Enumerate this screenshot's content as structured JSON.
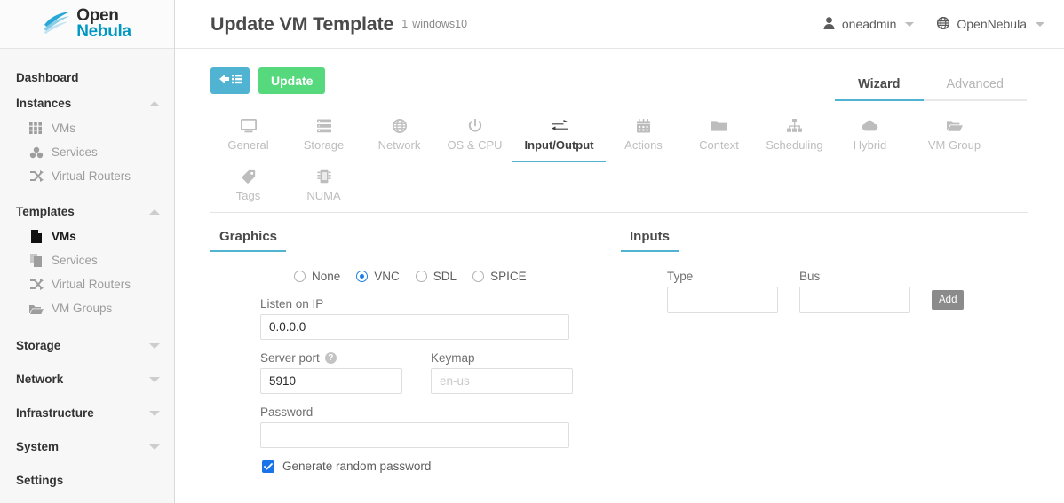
{
  "brand": {
    "logo_line1": "Open",
    "logo_line2": "Nebula",
    "accent": "#0098c3",
    "teal": "#4fb3d1",
    "green": "#56d87d",
    "blue": "#1a73e8"
  },
  "sidebar": {
    "groups": [
      {
        "label": "Dashboard",
        "icon": "",
        "collapsible": false,
        "items": []
      },
      {
        "label": "Instances",
        "caret": "up",
        "collapsible": true,
        "items": [
          {
            "label": "VMs",
            "icon": "grid-icon",
            "active": false
          },
          {
            "label": "Services",
            "icon": "services-icon",
            "active": false
          },
          {
            "label": "Virtual Routers",
            "icon": "shuffle-icon",
            "active": false
          }
        ]
      },
      {
        "label": "Templates",
        "caret": "up",
        "collapsible": true,
        "items": [
          {
            "label": "VMs",
            "icon": "file-icon",
            "active": true
          },
          {
            "label": "Services",
            "icon": "copy-icon",
            "active": false
          },
          {
            "label": "Virtual Routers",
            "icon": "shuffle-icon",
            "active": false
          },
          {
            "label": "VM Groups",
            "icon": "folder-icon",
            "active": false
          }
        ]
      },
      {
        "label": "Storage",
        "caret": "down",
        "collapsible": true,
        "items": []
      },
      {
        "label": "Network",
        "caret": "down",
        "collapsible": true,
        "items": []
      },
      {
        "label": "Infrastructure",
        "caret": "down",
        "collapsible": true,
        "items": []
      },
      {
        "label": "System",
        "caret": "down",
        "collapsible": true,
        "items": []
      },
      {
        "label": "Settings",
        "collapsible": false,
        "items": []
      }
    ]
  },
  "header": {
    "title": "Update VM Template",
    "object_id": "1",
    "object_name": "windows10",
    "user": "oneadmin",
    "group": "OpenNebula"
  },
  "toolbar": {
    "back_label": "",
    "update_label": "Update",
    "modes": [
      {
        "label": "Wizard",
        "active": true
      },
      {
        "label": "Advanced",
        "active": false
      }
    ]
  },
  "tabs": [
    {
      "label": "General",
      "icon": "monitor-icon",
      "active": false
    },
    {
      "label": "Storage",
      "icon": "storage-icon",
      "active": false
    },
    {
      "label": "Network",
      "icon": "globe-icon",
      "active": false
    },
    {
      "label": "OS & CPU",
      "icon": "power-icon",
      "active": false
    },
    {
      "label": "Input/Output",
      "icon": "exchange-icon",
      "active": true
    },
    {
      "label": "Actions",
      "icon": "calendar-icon",
      "active": false
    },
    {
      "label": "Context",
      "icon": "folder-icon",
      "active": false
    },
    {
      "label": "Scheduling",
      "icon": "sitemap-icon",
      "active": false
    },
    {
      "label": "Hybrid",
      "icon": "cloud-icon",
      "active": false
    },
    {
      "label": "VM Group",
      "icon": "folder-open-icon",
      "active": false
    },
    {
      "label": "Tags",
      "icon": "tag-icon",
      "active": false
    },
    {
      "label": "NUMA",
      "icon": "memory-icon",
      "active": false
    }
  ],
  "graphics": {
    "section_title": "Graphics",
    "options": [
      {
        "label": "None",
        "selected": false
      },
      {
        "label": "VNC",
        "selected": true
      },
      {
        "label": "SDL",
        "selected": false
      },
      {
        "label": "SPICE",
        "selected": false
      }
    ],
    "listen_label": "Listen on IP",
    "listen_value": "0.0.0.0",
    "listen_placeholder": "",
    "port_label": "Server port",
    "port_help": "?",
    "port_value": "5910",
    "keymap_label": "Keymap",
    "keymap_value": "",
    "keymap_placeholder": "en-us",
    "password_label": "Password",
    "password_value": "",
    "password_placeholder": "",
    "random_password_label": "Generate random password",
    "random_password_checked": true
  },
  "inputs": {
    "section_title": "Inputs",
    "type_label": "Type",
    "type_value": "",
    "bus_label": "Bus",
    "bus_value": "",
    "add_label": "Add"
  }
}
